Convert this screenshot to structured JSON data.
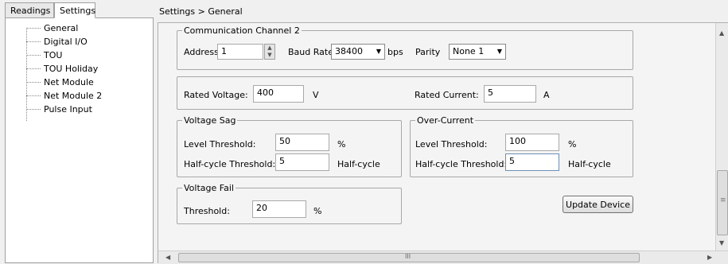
{
  "tabs": [
    {
      "label": "Readings"
    },
    {
      "label": "Settings"
    }
  ],
  "tree": {
    "items": [
      {
        "label": "General"
      },
      {
        "label": "Digital I/O"
      },
      {
        "label": "TOU"
      },
      {
        "label": "TOU Holiday"
      },
      {
        "label": "Net Module"
      },
      {
        "label": "Net Module 2"
      },
      {
        "label": "Pulse Input"
      }
    ]
  },
  "breadcrumb": "Settings > General",
  "comm": {
    "legend": "Communication Channel 2",
    "address_label": "Address",
    "address_value": "1",
    "baud_label": "Baud Rate",
    "baud_value": "38400",
    "baud_unit": "bps",
    "parity_label": "Parity",
    "parity_value": "None 1"
  },
  "rated": {
    "voltage_label": "Rated Voltage:",
    "voltage_value": "400",
    "voltage_unit": "V",
    "current_label": "Rated Current:",
    "current_value": "5",
    "current_unit": "A"
  },
  "sag": {
    "legend": "Voltage Sag",
    "level_label": "Level Threshold:",
    "level_value": "50",
    "level_unit": "%",
    "half_label": "Half-cycle Threshold:",
    "half_value": "5",
    "half_unit": "Half-cycle"
  },
  "overcurrent": {
    "legend": "Over-Current",
    "level_label": "Level Threshold:",
    "level_value": "100",
    "level_unit": "%",
    "half_label": "Half-cycle Threshold:",
    "half_value": "5",
    "half_unit": "Half-cycle"
  },
  "fail": {
    "legend": "Voltage Fail",
    "threshold_label": "Threshold:",
    "threshold_value": "20",
    "threshold_unit": "%"
  },
  "update_button": "Update Device",
  "scroll": {
    "h_grip": "III",
    "v_grip": "≡"
  }
}
